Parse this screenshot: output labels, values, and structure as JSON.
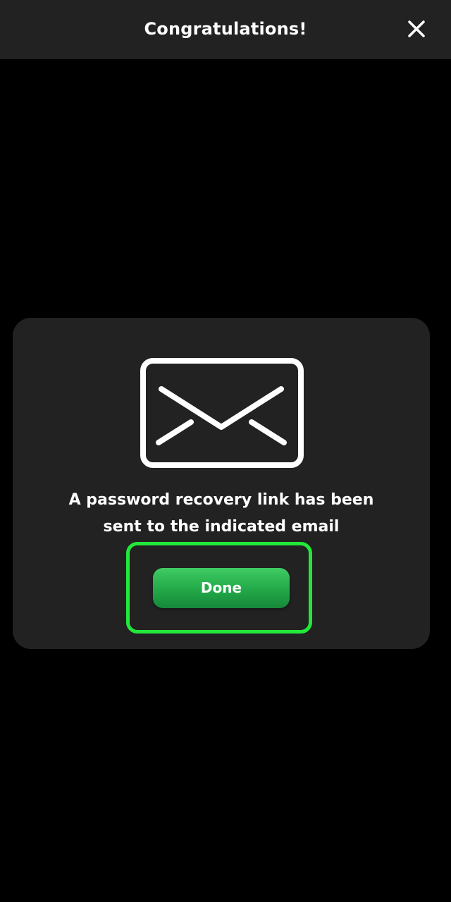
{
  "header": {
    "title": "Congratulations!",
    "close_icon": "close-icon"
  },
  "dialog": {
    "icon": "envelope-icon",
    "message_line1": "A password recovery link has been",
    "message_line2": "sent to the indicated email",
    "done_label": "Done"
  },
  "colors": {
    "background": "#000000",
    "panel": "#222222",
    "text": "#ffffff",
    "button_green": "#22a848",
    "highlight_green": "#22e83a"
  }
}
